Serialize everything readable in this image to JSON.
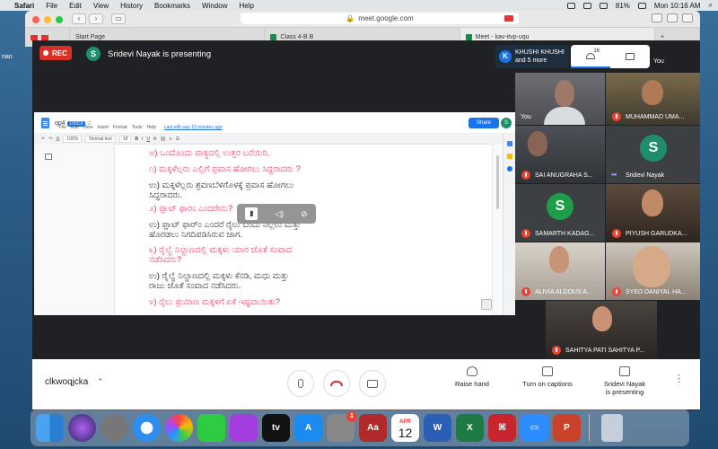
{
  "menubar": {
    "app": "Safari",
    "items": [
      "File",
      "Edit",
      "View",
      "History",
      "Bookmarks",
      "Window",
      "Help"
    ],
    "battery": "81%",
    "clock": "Mon 10:16 AM"
  },
  "browser": {
    "url": "meet.google.com",
    "tabs": [
      {
        "label": "Start Page"
      },
      {
        "label": "Class 4-B B"
      },
      {
        "label": "Meet - kav-itvp-uqu"
      }
    ]
  },
  "meet": {
    "rec_label": "REC",
    "presenter_initial": "S",
    "presenter_text": "Sridevi Nayak is presenting",
    "khushi_initial": "K",
    "khushi_name": "KHUSHI KHUSHI",
    "khushi_more": "and 5 more",
    "people_count": "16",
    "self_label": "You",
    "tiles": [
      {
        "name": "You",
        "muted": false,
        "dots": false
      },
      {
        "name": "MUHAMMAD UMA...",
        "muted": true,
        "dots": false
      },
      {
        "name": "SAI ANUGRAHA S...",
        "muted": true,
        "dots": false
      },
      {
        "name": "Sridevi Nayak",
        "muted": false,
        "dots": true,
        "initial": "S",
        "color": "#1e8e6e"
      },
      {
        "name": "SAMARTH KADAG...",
        "muted": true,
        "dots": false,
        "initial": "S",
        "color": "#1e9e4a"
      },
      {
        "name": "PIYUSH GARUDKA...",
        "muted": true,
        "dots": false
      },
      {
        "name": "ALIVIA ALDOUS A...",
        "muted": true,
        "dots": false
      },
      {
        "name": "SYED DANIYAL HA...",
        "muted": true,
        "dots": false
      },
      {
        "name": "SAHITYA PATI SAHITYA P...",
        "muted": true,
        "dots": false
      }
    ]
  },
  "doc": {
    "name": "qp4",
    "ext": ".DOCX",
    "menu": [
      "File",
      "Edit",
      "View",
      "Insert",
      "Format",
      "Tools",
      "Help"
    ],
    "last_edit": "Last edit was 15 minutes ago",
    "share": "Share",
    "avatar": "S",
    "zoom": "100%",
    "style": "Normal text",
    "font_size": "18",
    "lines": [
      {
        "text": "ಅ) ಒಂದೊಂದು  ವಾಕ್ಯದಲ್ಲಿ ಉತ್ತರ ಬರೆಯಿರಿ.",
        "red": true
      },
      {
        "text": "೧)  ಮಕ್ಕಳೆಲ್ಲರು ಎಲ್ಲಿಗೆ ಪ್ರವಾಸ ಹೋಗಲು ಸಿದ್ಧರಾದರು ?",
        "red": true
      },
      {
        "text": "ಉ)  ಮಕ್ಕಳೆಲ್ಲರು ಶ್ರವಣಬೆಳಗೊಳಕ್ಕೆ ಪ್ರವಾಸ ಹೋಗಲು",
        "red": false
      },
      {
        "text": "ಸಿದ್ಧರಾದರು.",
        "red": false
      },
      {
        "text": "೨)  ಪ್ಲಾಟ್ ಫಾರಂ ಎಂದರೇನು?",
        "red": true
      },
      {
        "text": "ಉ)  ಪ್ಲಾಟ್ ಫಾರ್ಂ ಎಂದರೆ ರೈಲು ಬಂದು ನಿಲ್ಲಲು ಮತ್ತು",
        "red": false
      },
      {
        "text": "ಹೊರಡಲು ನಿಗದಿಪಡಿಸಿರುವ ಜಾಗ.",
        "red": false
      },
      {
        "text": "೩)  ರೈಲ್ವೆ ನಿಲ್ದಾಣದಲ್ಲಿ ಮಕ್ಕಳು ಯಾರ ಜೊತೆ ಸಂವಾದ",
        "red": true
      },
      {
        "text": "ನಡೆಸಿದರು?",
        "red": true
      },
      {
        "text": "ಉ)  ರೈಲ್ವೆ ನಿಲ್ದಾಣದಲ್ಲಿ ಮಕ್ಕಳು ಕೆನಡಿ, ಮಧು ಮತ್ತು",
        "red": false
      },
      {
        "text": "ರಾಜು ಜೊತೆ ಸಂವಾದ ನಡೆಸಿದರು.",
        "red": false
      },
      {
        "text": "೪)  ರೈಲು ಪ್ರಯಾಣ ಮಕ್ಕಳಿಗೆ ಏಕೆ ಇಷ್ಟವಾಯಿತು?",
        "red": true
      }
    ]
  },
  "bottombar": {
    "meeting_code": "clkwoqjcka",
    "raise_hand": "Raise hand",
    "captions": "Turn on captions",
    "presenting_line1": "Sridevi Nayak",
    "presenting_line2": "is presenting"
  },
  "desktop": {
    "calendar_month": "APR",
    "calendar_day": "12",
    "settings_badge": "1"
  }
}
